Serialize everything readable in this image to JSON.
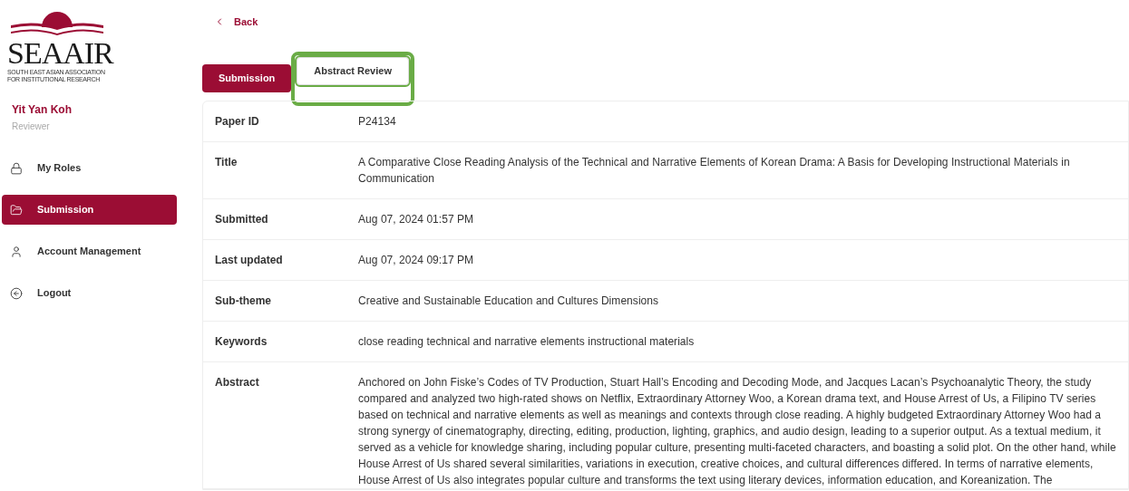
{
  "logo": {
    "wordmark": "SEAAIR",
    "subtitle_lines": [
      "SOUTH EAST ASIAN ASSOCIATION",
      "FOR INSTITUTIONAL RESEARCH"
    ]
  },
  "user": {
    "name": "Yit Yan Koh",
    "role": "Reviewer"
  },
  "sidebar": {
    "items": [
      {
        "kind": "lock",
        "label": "My Roles",
        "selected": false
      },
      {
        "kind": "folder",
        "label": "Submission",
        "selected": true
      },
      {
        "kind": "person",
        "label": "Account Management",
        "selected": false
      },
      {
        "kind": "logout",
        "label": "Logout",
        "selected": false
      }
    ]
  },
  "back_link": {
    "label": "Back"
  },
  "tabs": [
    {
      "label": "Submission",
      "selected": true,
      "highlighted": false
    },
    {
      "label": "Abstract Review",
      "selected": false,
      "highlighted": true
    }
  ],
  "details": [
    {
      "label": "Paper ID",
      "value": "P24134"
    },
    {
      "label": "Title",
      "value": "A Comparative Close Reading Analysis of the Technical and Narrative Elements of Korean Drama: A Basis for Developing Instructional Materials in Communication"
    },
    {
      "label": "Submitted",
      "value": "Aug 07, 2024 01:57 PM"
    },
    {
      "label": "Last updated",
      "value": "Aug 07, 2024 09:17 PM"
    },
    {
      "label": "Sub-theme",
      "value": "Creative and Sustainable Education and Cultures Dimensions"
    },
    {
      "label": "Keywords",
      "value": "close reading technical and narrative elements instructional materials"
    },
    {
      "label": "Abstract",
      "value": "Anchored on John Fiske’s Codes of TV Production, Stuart Hall’s Encoding and Decoding Mode, and Jacques Lacan’s Psychoanalytic Theory, the study compared and analyzed two high-rated shows on Netflix, Extraordinary Attorney Woo, a Korean drama text, and House Arrest of Us, a Filipino TV series based on technical and narrative elements as well as meanings and contexts through close reading. A highly budgeted Extraordinary Attorney Woo had a strong synergy of cinematography, directing, editing, production, lighting, graphics, and audio design, leading to a superior output. As a textual medium, it served as a vehicle for knowledge sharing, including popular culture, presenting multi-faceted characters, and boasting a solid plot. On the other hand, while House Arrest of Us shared several similarities, variations in execution, creative choices, and cultural differences differed. In terms of narrative elements, House Arrest of Us also integrates popular culture and transforms the text using literary devices, information education, and Koreanization. The"
    }
  ]
}
